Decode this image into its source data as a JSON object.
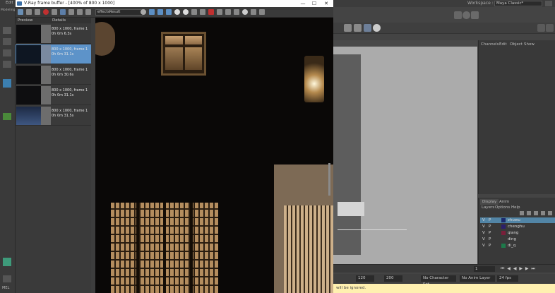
{
  "maya": {
    "workspace_label": "Workspace :",
    "workspace_value": "Maya Classic*",
    "channel_box_menu": [
      "Channels",
      "Edit",
      "Object",
      "Show"
    ],
    "layer_tabs": [
      "Display",
      "Anim"
    ],
    "layer_menu": [
      "Layers",
      "Options",
      "Help"
    ],
    "layers": [
      {
        "v": "V",
        "p": "P",
        "name": "zhuwu",
        "color": "#1a2a6e",
        "selected": true
      },
      {
        "v": "V",
        "p": "P",
        "name": "chenghu",
        "color": "#2c1f6b",
        "selected": false
      },
      {
        "v": "V",
        "p": "P",
        "name": "qiang",
        "color": "#7a1f3a",
        "selected": false
      },
      {
        "v": "V",
        "p": "P",
        "name": "ding",
        "color": "#3a3a3a",
        "selected": false
      },
      {
        "v": "V",
        "p": "P",
        "name": "di_q",
        "color": "#1d7a4a",
        "selected": false
      }
    ],
    "range_start": "120",
    "range_end": "200",
    "character_set": "No Character Set",
    "anim_layer": "No Anim Layer",
    "fps": "24 fps",
    "current_frame": "1",
    "status_text": "will be ignored.",
    "mel_label": "MEL",
    "left_menu_label": "Edit",
    "left_mode_label": "Modeling"
  },
  "vfb": {
    "title": "V-Ray frame buffer - [400% of 800 x 1000]",
    "minimize": "—",
    "maximize": "☐",
    "close": "✕",
    "channel": "effectsResult",
    "history_headers": [
      "Preview",
      "Details"
    ],
    "history": [
      {
        "res": "800 x 1000, frame 1",
        "time": "0h 0m 6.3s",
        "selected": false
      },
      {
        "res": "800 x 1000, frame 1",
        "time": "0h 0m 31.1s",
        "selected": true
      },
      {
        "res": "800 x 1000, frame 1",
        "time": "0h 0m 30.6s",
        "selected": false
      },
      {
        "res": "800 x 1000, frame 1",
        "time": "0h 0m 31.1s",
        "selected": false
      },
      {
        "res": "800 x 1000, frame 1",
        "time": "0h 0m 31.5s",
        "selected": false
      }
    ]
  }
}
